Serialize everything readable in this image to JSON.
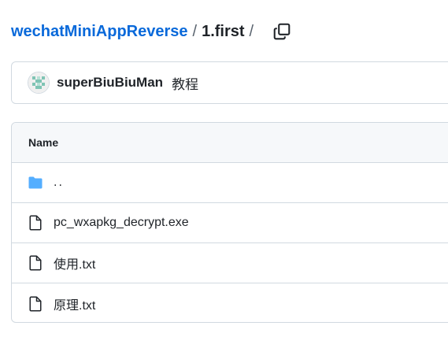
{
  "breadcrumb": {
    "repo": "wechatMiniAppReverse",
    "separator": "/",
    "current": "1.first",
    "trailing_separator": "/",
    "copy_icon": "copy-icon"
  },
  "commit": {
    "author": "superBiuBiuMan",
    "message": "教程",
    "avatar_icon": "identicon-avatar"
  },
  "table": {
    "header": "Name",
    "rows": [
      {
        "name": "..",
        "icon": "folder-icon"
      },
      {
        "name": "pc_wxapkg_decrypt.exe",
        "icon": "file-icon"
      },
      {
        "name": "使用.txt",
        "icon": "file-icon"
      },
      {
        "name": "原理.txt",
        "icon": "file-icon"
      }
    ]
  },
  "colors": {
    "link": "#0969da",
    "text": "#1f2328",
    "border": "#d1d9e0",
    "header_bg": "#f6f8fa",
    "folder": "#54aeff"
  }
}
